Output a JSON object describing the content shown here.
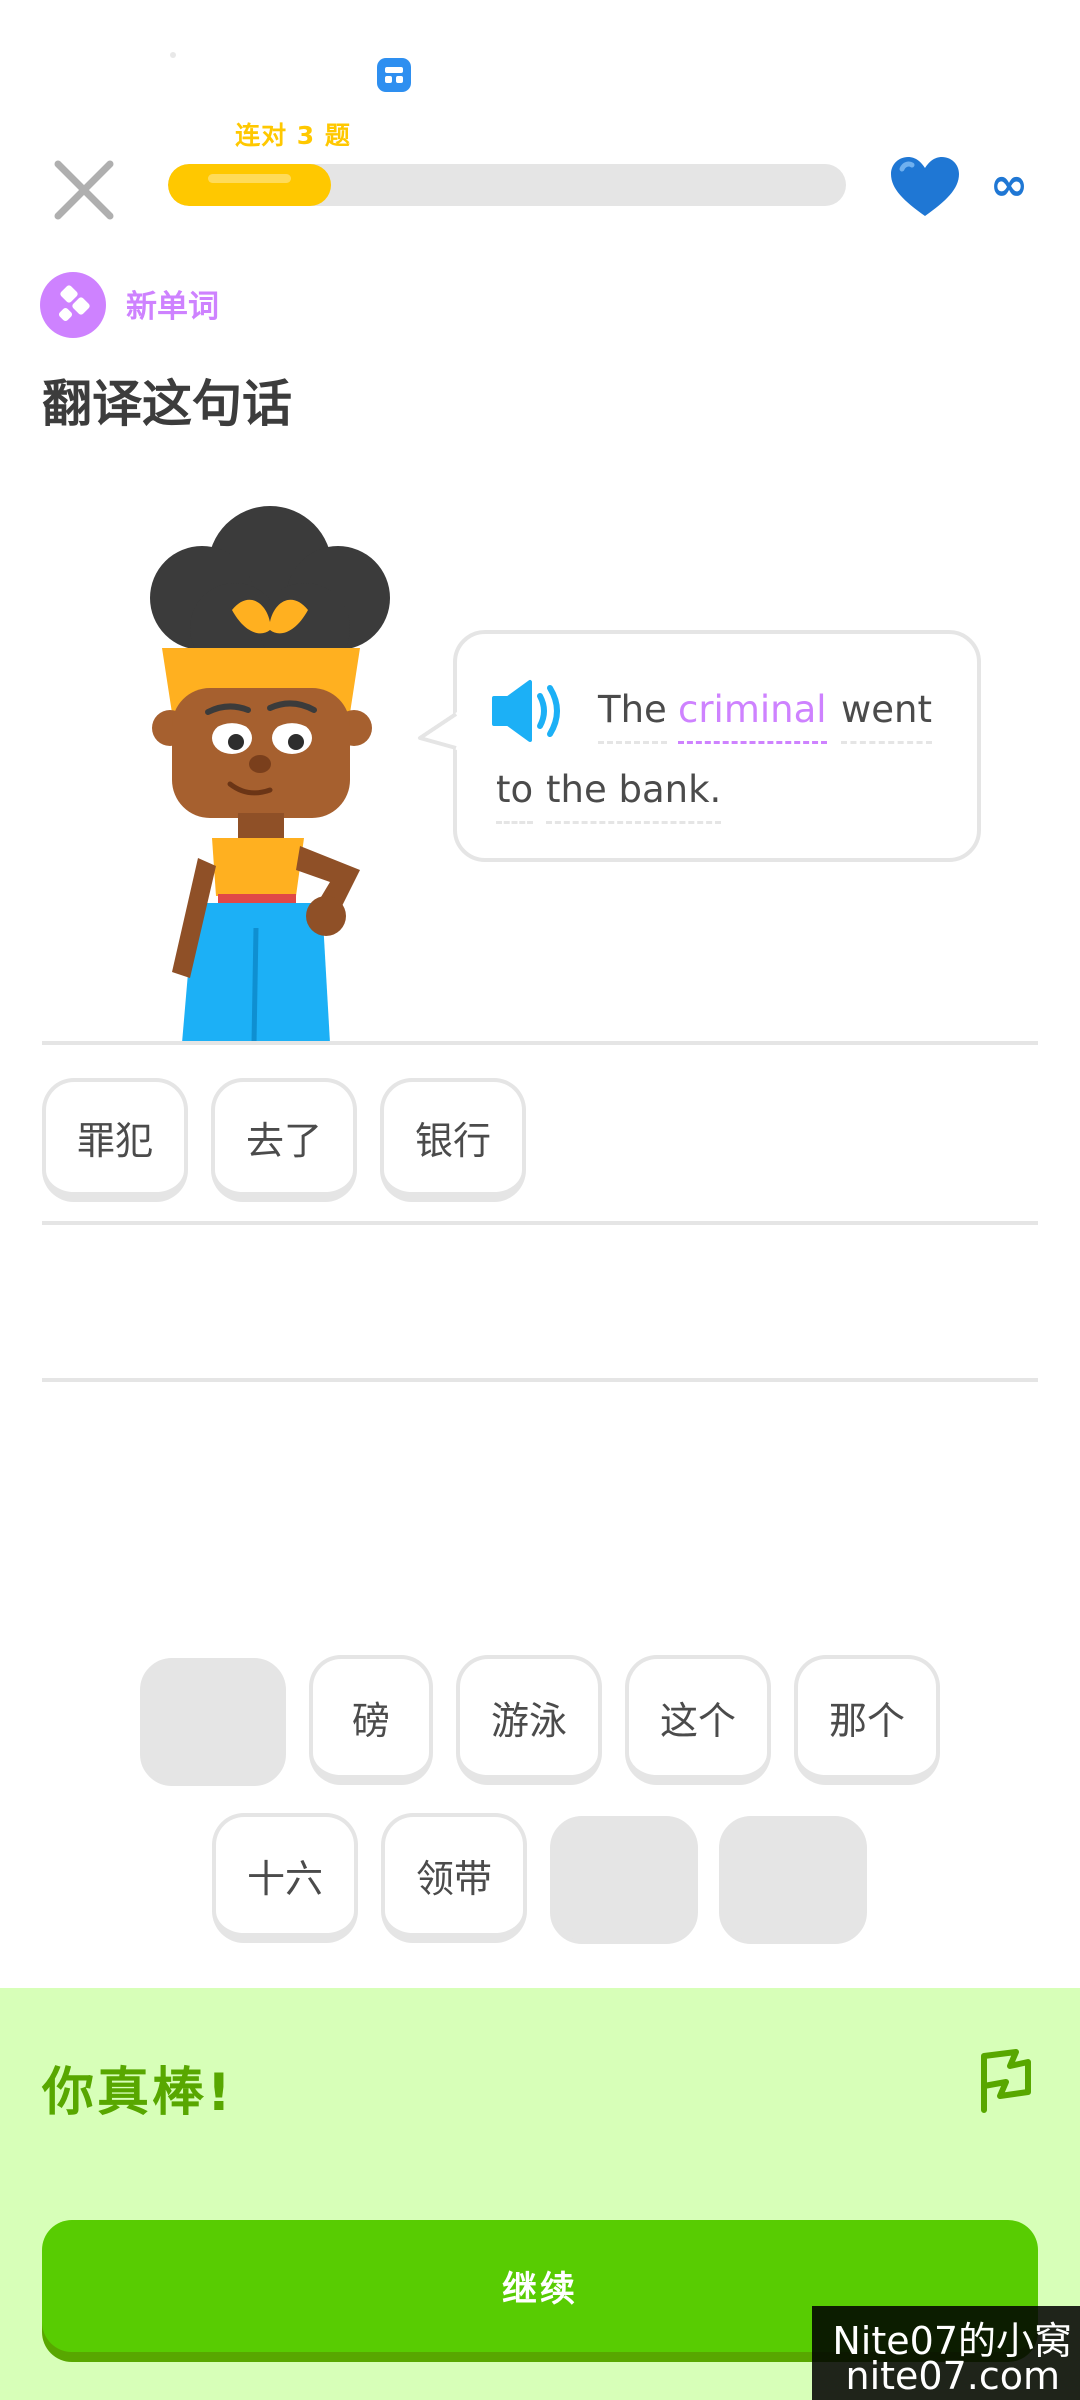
{
  "status_bar": {
    "app_icon": "app-notification-icon"
  },
  "header": {
    "streak_text": "连对 3 题",
    "progress_fraction": 0.24,
    "hearts": "∞",
    "close_icon": "close-icon",
    "heart_icon": "heart-icon"
  },
  "lesson": {
    "badge_icon": "new-word-icon",
    "badge_label": "新单词",
    "prompt": "翻译这句话"
  },
  "bubble": {
    "speaker_icon": "speaker-icon",
    "words": [
      "The",
      "criminal",
      "went",
      "to",
      "the bank."
    ]
  },
  "answer_tiles": [
    "罪犯",
    "去了",
    "银行"
  ],
  "word_bank": {
    "row1": [
      "",
      "磅",
      "游泳",
      "这个",
      "那个"
    ],
    "row2": [
      "十六",
      "领带",
      "",
      ""
    ]
  },
  "feedback": {
    "message": "你真棒!",
    "flag_icon": "report-flag-icon",
    "continue_label": "继续"
  },
  "watermark": {
    "line1": "Nite07的小窝",
    "line2": "nite07.com"
  },
  "colors": {
    "accent_yellow": "#ffc800",
    "new_word_purple": "#ce82ff",
    "heart_blue": "#1f77d4",
    "success_green": "#58cc02",
    "success_bg": "#d7ffb8",
    "success_text": "#58a700"
  }
}
